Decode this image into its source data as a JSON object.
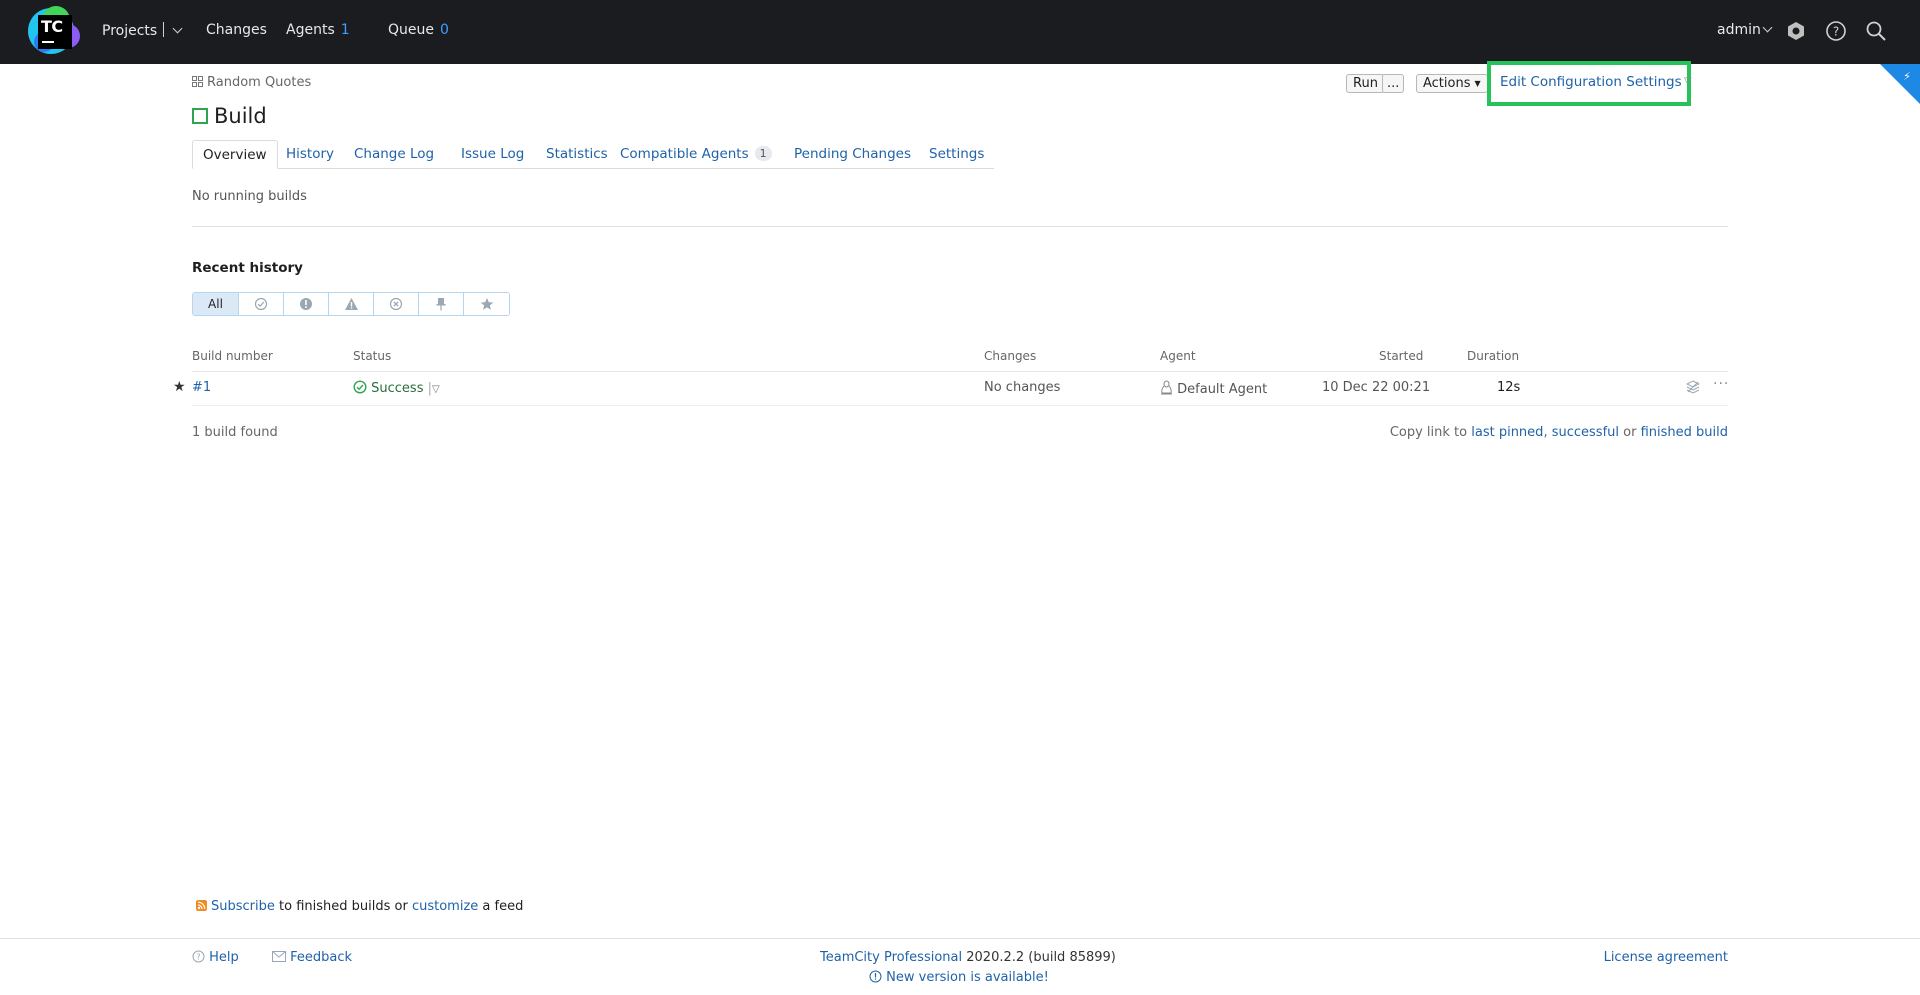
{
  "topbar": {
    "logo_text": "TC",
    "nav": {
      "projects": "Projects",
      "changes": "Changes",
      "agents": "Agents",
      "agents_count": "1",
      "queue": "Queue",
      "queue_count": "0"
    },
    "user": "admin",
    "icons": [
      "settings-icon",
      "help-icon",
      "search-icon"
    ]
  },
  "breadcrumb": {
    "project": "Random Quotes"
  },
  "page": {
    "title": "Build"
  },
  "actions": {
    "run": "Run",
    "run_more": "...",
    "actions": "Actions",
    "edit_config": "Edit Configuration Settings"
  },
  "tabs": [
    {
      "label": "Overview",
      "active": true
    },
    {
      "label": "History"
    },
    {
      "label": "Change Log"
    },
    {
      "label": "Issue Log"
    },
    {
      "label": "Statistics"
    },
    {
      "label": "Compatible Agents",
      "badge": "1"
    },
    {
      "label": "Pending Changes"
    },
    {
      "label": "Settings"
    }
  ],
  "running": {
    "text": "No running builds"
  },
  "history": {
    "title": "Recent history",
    "filters": [
      {
        "label": "All",
        "active": true
      },
      {
        "icon": "success-filter-icon"
      },
      {
        "icon": "failed-filter-icon"
      },
      {
        "icon": "warning-filter-icon"
      },
      {
        "icon": "cancelled-filter-icon"
      },
      {
        "icon": "pinned-filter-icon"
      },
      {
        "icon": "starred-filter-icon"
      }
    ],
    "columns": {
      "number": "Build number",
      "status": "Status",
      "changes": "Changes",
      "agent": "Agent",
      "started": "Started",
      "duration": "Duration"
    },
    "rows": [
      {
        "number": "#1",
        "status": "Success",
        "changes": "No changes",
        "agent": "Default Agent",
        "started": "10 Dec 22 00:21",
        "duration": "12s"
      }
    ],
    "found": "1 build found",
    "copy_link": {
      "prefix": "Copy link to",
      "last_pinned": "last pinned",
      "comma": ",",
      "successful": "successful",
      "or": "or",
      "finished": "finished build"
    }
  },
  "feed": {
    "subscribe": "Subscribe",
    "middle": "to finished builds or",
    "customize": "customize",
    "suffix": "a feed"
  },
  "footer": {
    "help": "Help",
    "feedback": "Feedback",
    "product": "TeamCity Professional",
    "version": "2020.2.2 (build 85899)",
    "new_version": "New version is available!",
    "license": "License agreement"
  },
  "colors": {
    "topbar_bg": "#1b1c1f",
    "link": "#1f62a8",
    "success": "#2ea44f",
    "highlight": "#27c35a"
  }
}
